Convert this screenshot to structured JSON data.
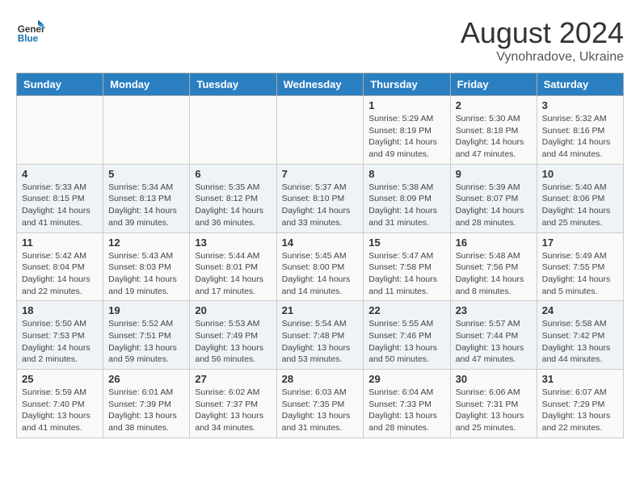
{
  "header": {
    "logo_line1": "General",
    "logo_line2": "Blue",
    "title": "August 2024",
    "subtitle": "Vynohradove, Ukraine"
  },
  "weekdays": [
    "Sunday",
    "Monday",
    "Tuesday",
    "Wednesday",
    "Thursday",
    "Friday",
    "Saturday"
  ],
  "weeks": [
    [
      {
        "date": "",
        "info": ""
      },
      {
        "date": "",
        "info": ""
      },
      {
        "date": "",
        "info": ""
      },
      {
        "date": "",
        "info": ""
      },
      {
        "date": "1",
        "info": "Sunrise: 5:29 AM\nSunset: 8:19 PM\nDaylight: 14 hours\nand 49 minutes."
      },
      {
        "date": "2",
        "info": "Sunrise: 5:30 AM\nSunset: 8:18 PM\nDaylight: 14 hours\nand 47 minutes."
      },
      {
        "date": "3",
        "info": "Sunrise: 5:32 AM\nSunset: 8:16 PM\nDaylight: 14 hours\nand 44 minutes."
      }
    ],
    [
      {
        "date": "4",
        "info": "Sunrise: 5:33 AM\nSunset: 8:15 PM\nDaylight: 14 hours\nand 41 minutes."
      },
      {
        "date": "5",
        "info": "Sunrise: 5:34 AM\nSunset: 8:13 PM\nDaylight: 14 hours\nand 39 minutes."
      },
      {
        "date": "6",
        "info": "Sunrise: 5:35 AM\nSunset: 8:12 PM\nDaylight: 14 hours\nand 36 minutes."
      },
      {
        "date": "7",
        "info": "Sunrise: 5:37 AM\nSunset: 8:10 PM\nDaylight: 14 hours\nand 33 minutes."
      },
      {
        "date": "8",
        "info": "Sunrise: 5:38 AM\nSunset: 8:09 PM\nDaylight: 14 hours\nand 31 minutes."
      },
      {
        "date": "9",
        "info": "Sunrise: 5:39 AM\nSunset: 8:07 PM\nDaylight: 14 hours\nand 28 minutes."
      },
      {
        "date": "10",
        "info": "Sunrise: 5:40 AM\nSunset: 8:06 PM\nDaylight: 14 hours\nand 25 minutes."
      }
    ],
    [
      {
        "date": "11",
        "info": "Sunrise: 5:42 AM\nSunset: 8:04 PM\nDaylight: 14 hours\nand 22 minutes."
      },
      {
        "date": "12",
        "info": "Sunrise: 5:43 AM\nSunset: 8:03 PM\nDaylight: 14 hours\nand 19 minutes."
      },
      {
        "date": "13",
        "info": "Sunrise: 5:44 AM\nSunset: 8:01 PM\nDaylight: 14 hours\nand 17 minutes."
      },
      {
        "date": "14",
        "info": "Sunrise: 5:45 AM\nSunset: 8:00 PM\nDaylight: 14 hours\nand 14 minutes."
      },
      {
        "date": "15",
        "info": "Sunrise: 5:47 AM\nSunset: 7:58 PM\nDaylight: 14 hours\nand 11 minutes."
      },
      {
        "date": "16",
        "info": "Sunrise: 5:48 AM\nSunset: 7:56 PM\nDaylight: 14 hours\nand 8 minutes."
      },
      {
        "date": "17",
        "info": "Sunrise: 5:49 AM\nSunset: 7:55 PM\nDaylight: 14 hours\nand 5 minutes."
      }
    ],
    [
      {
        "date": "18",
        "info": "Sunrise: 5:50 AM\nSunset: 7:53 PM\nDaylight: 14 hours\nand 2 minutes."
      },
      {
        "date": "19",
        "info": "Sunrise: 5:52 AM\nSunset: 7:51 PM\nDaylight: 13 hours\nand 59 minutes."
      },
      {
        "date": "20",
        "info": "Sunrise: 5:53 AM\nSunset: 7:49 PM\nDaylight: 13 hours\nand 56 minutes."
      },
      {
        "date": "21",
        "info": "Sunrise: 5:54 AM\nSunset: 7:48 PM\nDaylight: 13 hours\nand 53 minutes."
      },
      {
        "date": "22",
        "info": "Sunrise: 5:55 AM\nSunset: 7:46 PM\nDaylight: 13 hours\nand 50 minutes."
      },
      {
        "date": "23",
        "info": "Sunrise: 5:57 AM\nSunset: 7:44 PM\nDaylight: 13 hours\nand 47 minutes."
      },
      {
        "date": "24",
        "info": "Sunrise: 5:58 AM\nSunset: 7:42 PM\nDaylight: 13 hours\nand 44 minutes."
      }
    ],
    [
      {
        "date": "25",
        "info": "Sunrise: 5:59 AM\nSunset: 7:40 PM\nDaylight: 13 hours\nand 41 minutes."
      },
      {
        "date": "26",
        "info": "Sunrise: 6:01 AM\nSunset: 7:39 PM\nDaylight: 13 hours\nand 38 minutes."
      },
      {
        "date": "27",
        "info": "Sunrise: 6:02 AM\nSunset: 7:37 PM\nDaylight: 13 hours\nand 34 minutes."
      },
      {
        "date": "28",
        "info": "Sunrise: 6:03 AM\nSunset: 7:35 PM\nDaylight: 13 hours\nand 31 minutes."
      },
      {
        "date": "29",
        "info": "Sunrise: 6:04 AM\nSunset: 7:33 PM\nDaylight: 13 hours\nand 28 minutes."
      },
      {
        "date": "30",
        "info": "Sunrise: 6:06 AM\nSunset: 7:31 PM\nDaylight: 13 hours\nand 25 minutes."
      },
      {
        "date": "31",
        "info": "Sunrise: 6:07 AM\nSunset: 7:29 PM\nDaylight: 13 hours\nand 22 minutes."
      }
    ]
  ]
}
